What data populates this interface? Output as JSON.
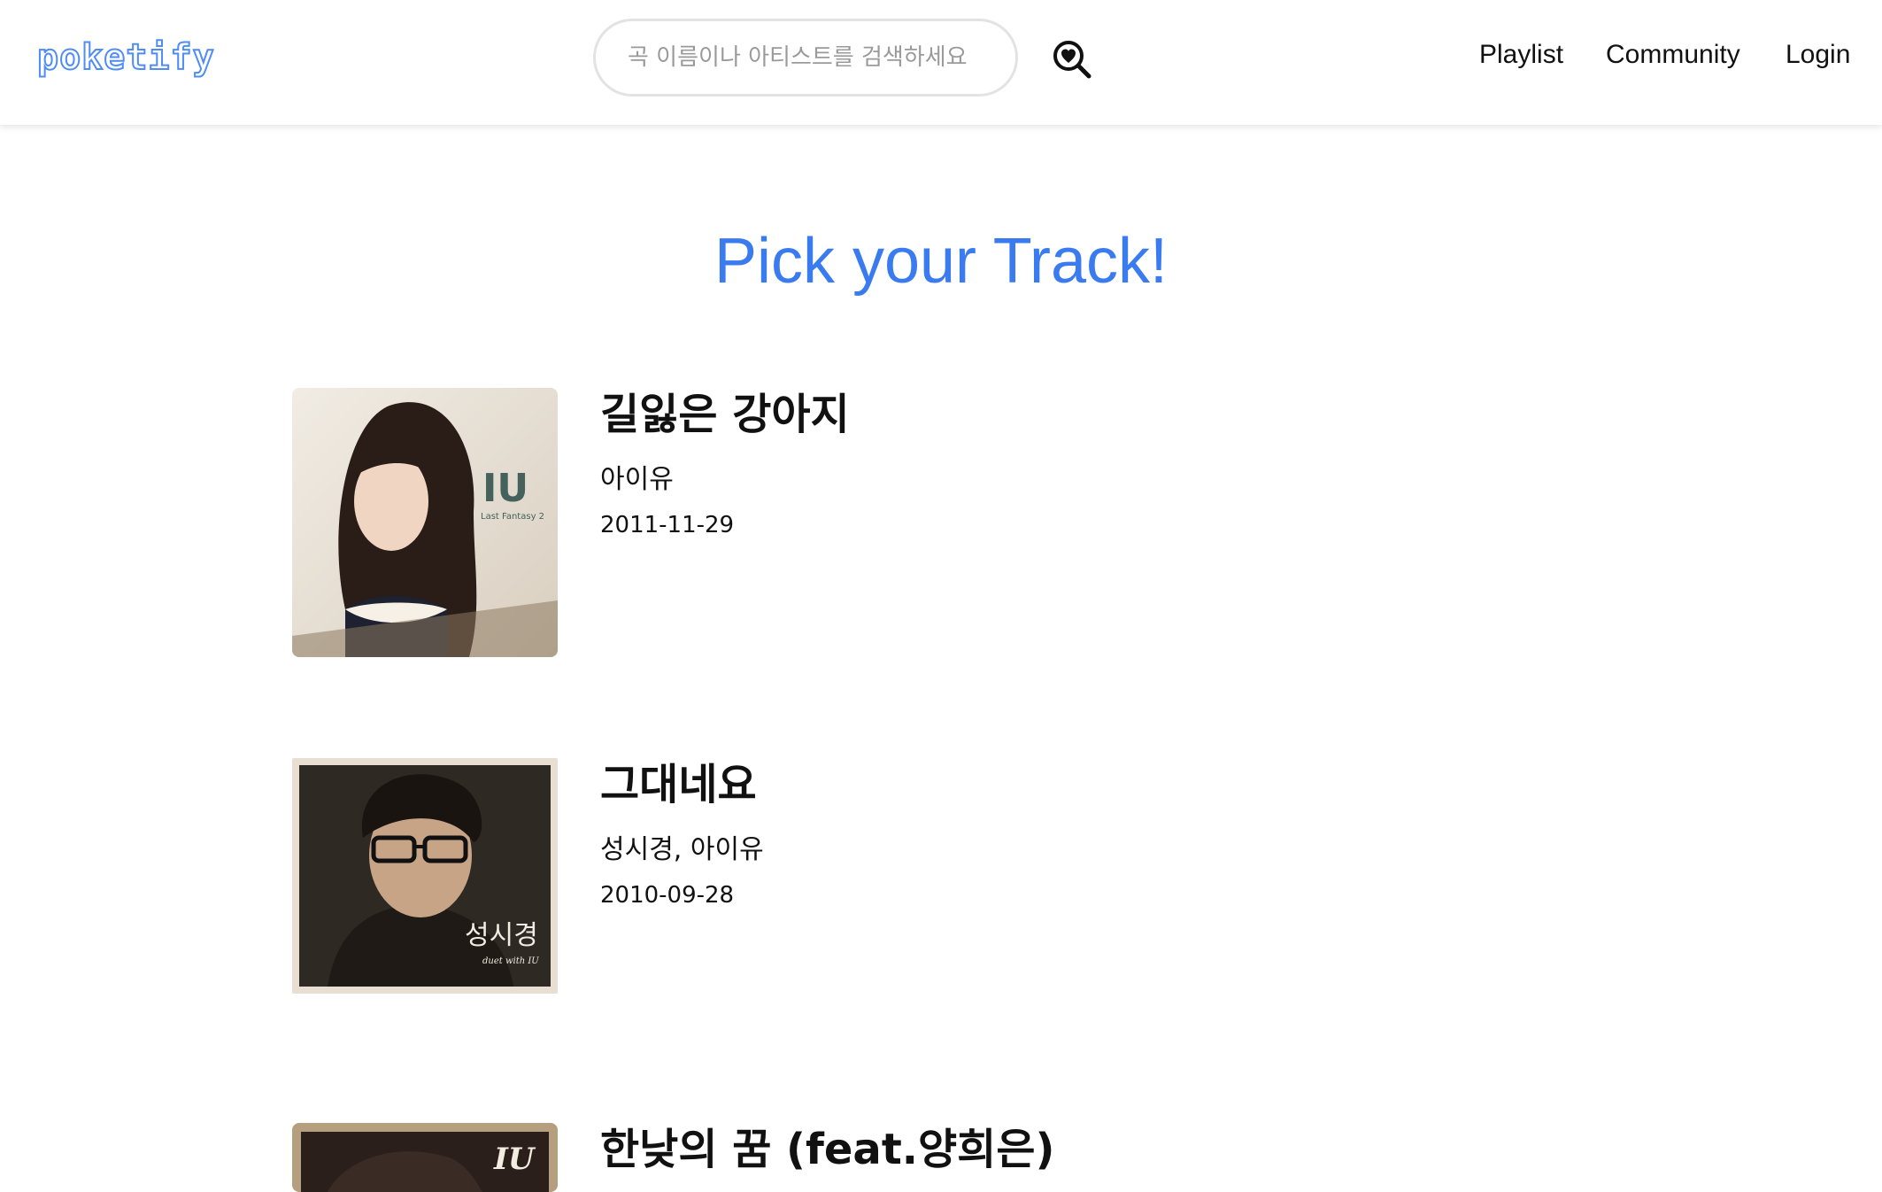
{
  "header": {
    "logo_text": "poketify",
    "search": {
      "placeholder": "곡 이름이나 아티스트를 검색하세요"
    },
    "nav": {
      "playlist": "Playlist",
      "community": "Community",
      "login": "Login"
    }
  },
  "main": {
    "title": "Pick your Track!",
    "tracks": [
      {
        "title": "길잃은 강아지",
        "artist": "아이유",
        "date": "2011-11-29",
        "cover_text": "IU",
        "cover_subtext": "Last Fantasy 2"
      },
      {
        "title": "그대네요",
        "artist": "성시경, 아이유",
        "date": "2010-09-28",
        "cover_text": "성시경",
        "cover_subtext": "duet with IU"
      },
      {
        "title": "한낮의 꿈 (feat.양희은)",
        "artist": "",
        "date": "",
        "cover_text": "IU",
        "cover_subtext": ""
      }
    ]
  },
  "colors": {
    "accent": "#3a7cf0",
    "logo": "#4f8cf6"
  }
}
